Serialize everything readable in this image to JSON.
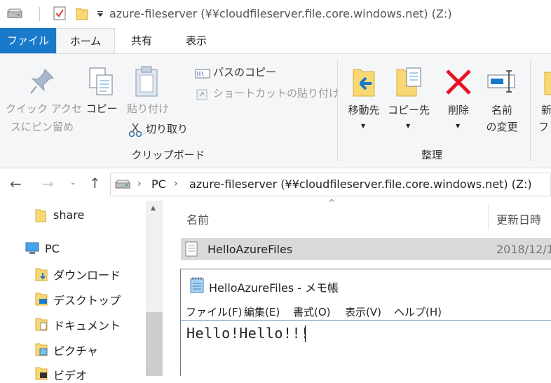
{
  "window": {
    "title": "azure-fileserver (¥¥cloudfileserver.file.core.windows.net) (Z:)"
  },
  "ribbon_tabs": [
    {
      "label": "ファイル"
    },
    {
      "label": "ホーム"
    },
    {
      "label": "共有"
    },
    {
      "label": "表示"
    }
  ],
  "ribbon": {
    "pin_label_1": "クイック アクセ",
    "pin_label_2": "スにピン留め",
    "copy": "コピー",
    "paste": "貼り付け",
    "copy_path": "パスのコピー",
    "paste_shortcut": "ショートカットの貼り付け",
    "cut": "切り取り",
    "clipboard_group": "クリップボード",
    "move_to": "移動先",
    "copy_to": "コピー先",
    "delete": "削除",
    "rename_1": "名前",
    "rename_2": "の変更",
    "new_1": "新",
    "new_2": "フォ",
    "organize_group": "整理"
  },
  "address": {
    "pc": "PC",
    "location": "azure-fileserver (¥¥cloudfileserver.file.core.windows.net) (Z:)"
  },
  "nav": [
    {
      "label": "share"
    },
    {
      "label": "PC"
    },
    {
      "label": "ダウンロード"
    },
    {
      "label": "デスクトップ"
    },
    {
      "label": "ドキュメント"
    },
    {
      "label": "ピクチャ"
    },
    {
      "label": "ビデオ"
    }
  ],
  "columns": {
    "name": "名前",
    "modified": "更新日時"
  },
  "files": [
    {
      "name": "HelloAzureFiles",
      "modified": "2018/12/1"
    }
  ],
  "notepad": {
    "title": "HelloAzureFiles - メモ帳",
    "menu": [
      "ファイル(F)",
      "編集(E)",
      "書式(O)",
      "表示(V)",
      "ヘルプ(H)"
    ],
    "content": "Hello!Hello!!!"
  },
  "colors": {
    "accent": "#1979ca",
    "delete_red": "#e81123",
    "folder_yellow": "#f8d775"
  }
}
